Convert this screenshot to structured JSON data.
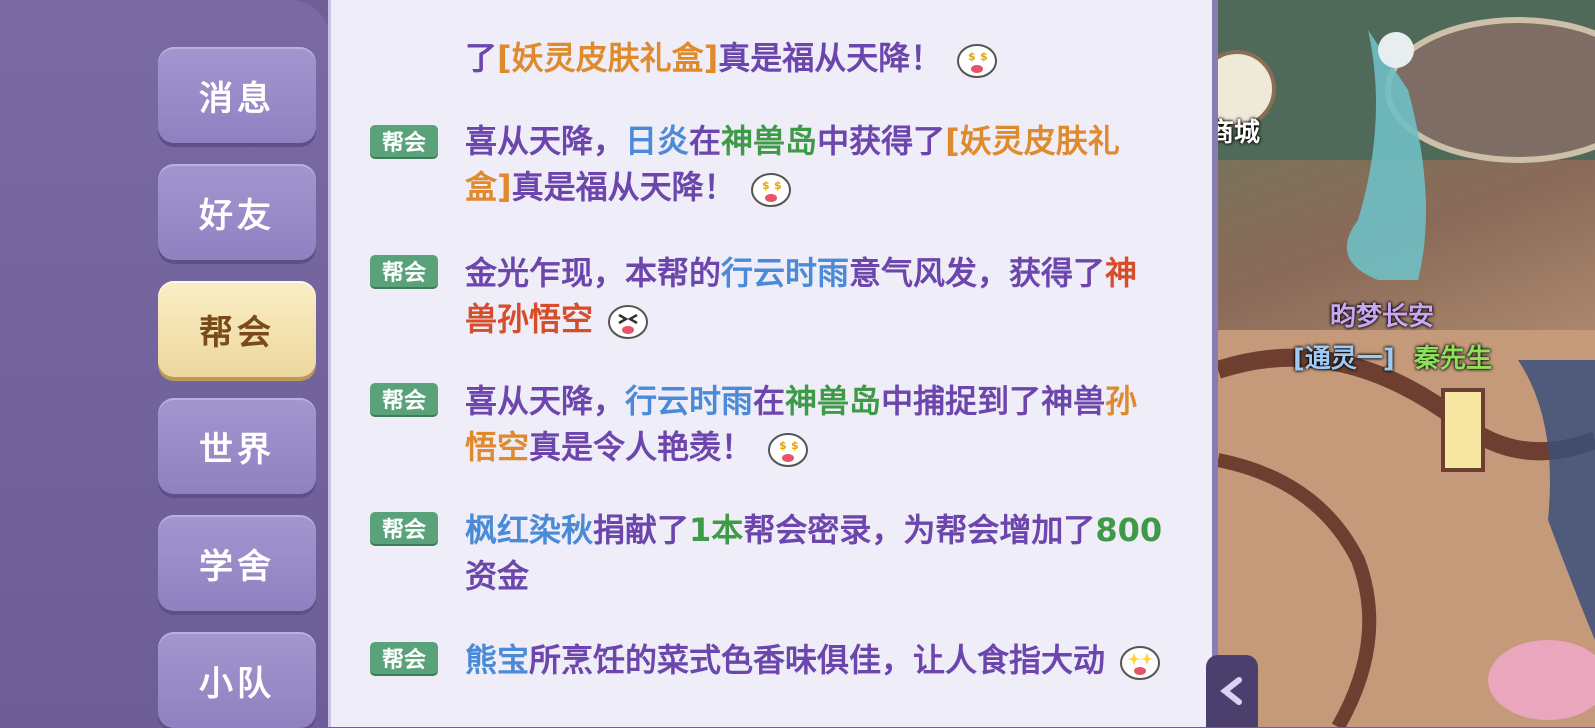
{
  "sidebar": {
    "tabs": [
      {
        "label": "消息",
        "active": false
      },
      {
        "label": "好友",
        "active": false
      },
      {
        "label": "帮会",
        "active": true
      },
      {
        "label": "世界",
        "active": false
      },
      {
        "label": "学舍",
        "active": false
      },
      {
        "label": "小队",
        "active": false
      }
    ]
  },
  "chat": {
    "messages": [
      {
        "channel": "",
        "segments": [
          {
            "t": "了"
          },
          {
            "t": "[妖灵皮肤礼盒]",
            "c": "orange"
          },
          {
            "t": "真是福从天降！"
          }
        ],
        "emoji": "money-eyes-emoji-icon"
      },
      {
        "channel": "帮会",
        "segments": [
          {
            "t": "喜从天降，"
          },
          {
            "t": "日炎",
            "c": "blue"
          },
          {
            "t": "在"
          },
          {
            "t": "神兽岛",
            "c": "green"
          },
          {
            "t": "中获得了"
          },
          {
            "t": "[妖灵皮肤礼盒]",
            "c": "orange"
          },
          {
            "t": "真是福从天降！"
          }
        ],
        "emoji": "money-eyes-emoji-icon"
      },
      {
        "channel": "帮会",
        "segments": [
          {
            "t": "金光乍现，本帮的"
          },
          {
            "t": "行云时雨",
            "c": "blue"
          },
          {
            "t": "意气风发，获得了"
          },
          {
            "t": "神兽孙悟空",
            "c": "red"
          }
        ],
        "emoji": "excited-emoji-icon"
      },
      {
        "channel": "帮会",
        "segments": [
          {
            "t": "喜从天降，"
          },
          {
            "t": "行云时雨",
            "c": "blue"
          },
          {
            "t": "在"
          },
          {
            "t": "神兽岛",
            "c": "green"
          },
          {
            "t": "中捕捉到了神兽"
          },
          {
            "t": "孙悟空",
            "c": "orange"
          },
          {
            "t": "真是令人艳羡！"
          }
        ],
        "emoji": "money-eyes-emoji-icon"
      },
      {
        "channel": "帮会",
        "segments": [
          {
            "t": "枫红染秋",
            "c": "blue"
          },
          {
            "t": "捐献了"
          },
          {
            "t": "1本",
            "c": "green"
          },
          {
            "t": "帮会密录，为帮会增加了"
          },
          {
            "t": "800",
            "c": "green"
          },
          {
            "t": "资金"
          }
        ],
        "emoji": ""
      },
      {
        "channel": "帮会",
        "segments": [
          {
            "t": "熊宝",
            "c": "blue"
          },
          {
            "t": "所烹饪的菜式色香味俱佳，让人食指大动"
          }
        ],
        "emoji": "sparkle-eyes-emoji-icon"
      }
    ]
  },
  "scene": {
    "city_label": "商城",
    "player_title": "昀梦长安",
    "player_name_prefix": "[通灵一]",
    "player_name": "秦先生"
  },
  "colors": {
    "orange": "#e08a2e",
    "blue": "#4b8ad6",
    "green": "#3e9a47",
    "red": "#d64d2c",
    "purple": "#6c46ad"
  }
}
